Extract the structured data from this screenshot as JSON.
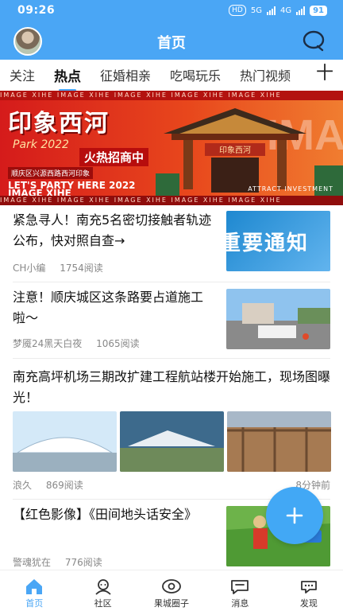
{
  "status_bar": {
    "time": "09:26",
    "hd": "HD",
    "network": "5G",
    "network2": "4G",
    "battery": "91"
  },
  "header": {
    "title": "首页"
  },
  "tabs": [
    {
      "label": "关注"
    },
    {
      "label": "热点"
    },
    {
      "label": "征婚相亲"
    },
    {
      "label": "吃喝玩乐"
    },
    {
      "label": "热门视频"
    }
  ],
  "tab_add_label": "十",
  "banner": {
    "ticker_text": "IMAGE  XIHE  IMAGE  XIHE  IMAGE  XIHE  IMAGE  XIHE  IMAGE  XIHE",
    "title": "印象西河",
    "park": "Park 2022",
    "hot": "火热招商中",
    "address": "顺庆区兴源西路西河印象",
    "party": "LET'S PARTY HERE 2022",
    "image_text": "IMAGE XIHE",
    "attract": "ATTRACT INVESTMENT",
    "gate_sign": "印象西河"
  },
  "feed": [
    {
      "title": "紧急寻人！南充5名密切接触者轨迹公布，快对照自查→",
      "author": "CH小编",
      "reads": "1754阅读",
      "thumb_text": "重要通知"
    },
    {
      "title": "注意！顺庆城区这条路要占道施工啦～",
      "author": "梦魇24黑天白夜",
      "reads": "1065阅读"
    },
    {
      "title": "南充高坪机场三期改扩建工程航站楼开始施工，现场图曝光！",
      "author": "浪久",
      "reads": "869阅读",
      "time": "8分钟前"
    },
    {
      "title": "【红色影像】《田间地头话安全》",
      "author": "警魂犹在",
      "reads": "776阅读"
    }
  ],
  "bottom_nav": [
    {
      "label": "首页"
    },
    {
      "label": "社区"
    },
    {
      "label": "果城圈子"
    },
    {
      "label": "消息"
    },
    {
      "label": "发现"
    }
  ],
  "colors": {
    "accent": "#4aa6f5",
    "banner_red": "#d51b1b"
  }
}
